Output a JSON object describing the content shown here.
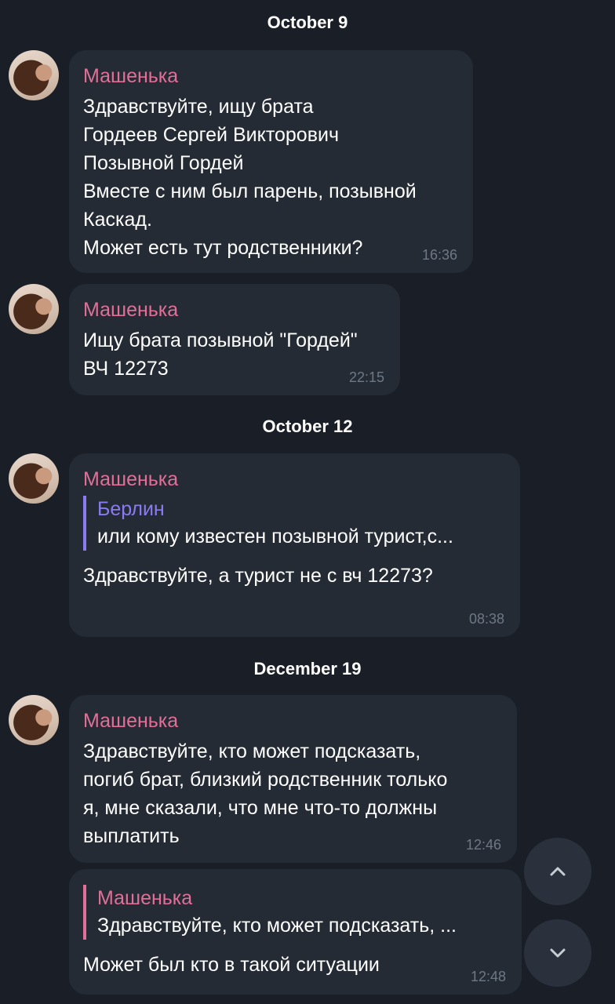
{
  "dates": [
    "October 9",
    "October 12",
    "December 19"
  ],
  "messages": [
    {
      "sender": "Машенька",
      "text": "Здравствуйте, ищу брата\nГордеев Сергей Викторович\nПозывной Гордей\nВместе с ним был парень, позывной\nКаскад.\nМожет есть тут родственники?",
      "time": "16:36"
    },
    {
      "sender": "Машенька",
      "text": "Ищу брата позывной \"Гордей\"\nВЧ 12273",
      "time": "22:15"
    },
    {
      "sender": "Машенька",
      "quote_name": "Берлин",
      "quote_text": "или кому известен позывной турист,с...",
      "text": "Здравствуйте, а турист не с вч  12273?",
      "time": "08:38"
    },
    {
      "sender": "Машенька",
      "text": "Здравствуйте, кто может подсказать,\nпогиб брат, близкий родственник только\nя, мне сказали, что мне что-то должны\nвыплатить",
      "time": "12:46"
    },
    {
      "quote_name": "Машенька",
      "quote_text": "Здравствуйте, кто может подсказать, ...",
      "text": "Может был кто в такой ситуации",
      "time": "12:48"
    }
  ],
  "icons": {
    "scroll_up": "chevron-up-icon",
    "scroll_down": "chevron-down-icon",
    "avatar": "user-avatar"
  }
}
